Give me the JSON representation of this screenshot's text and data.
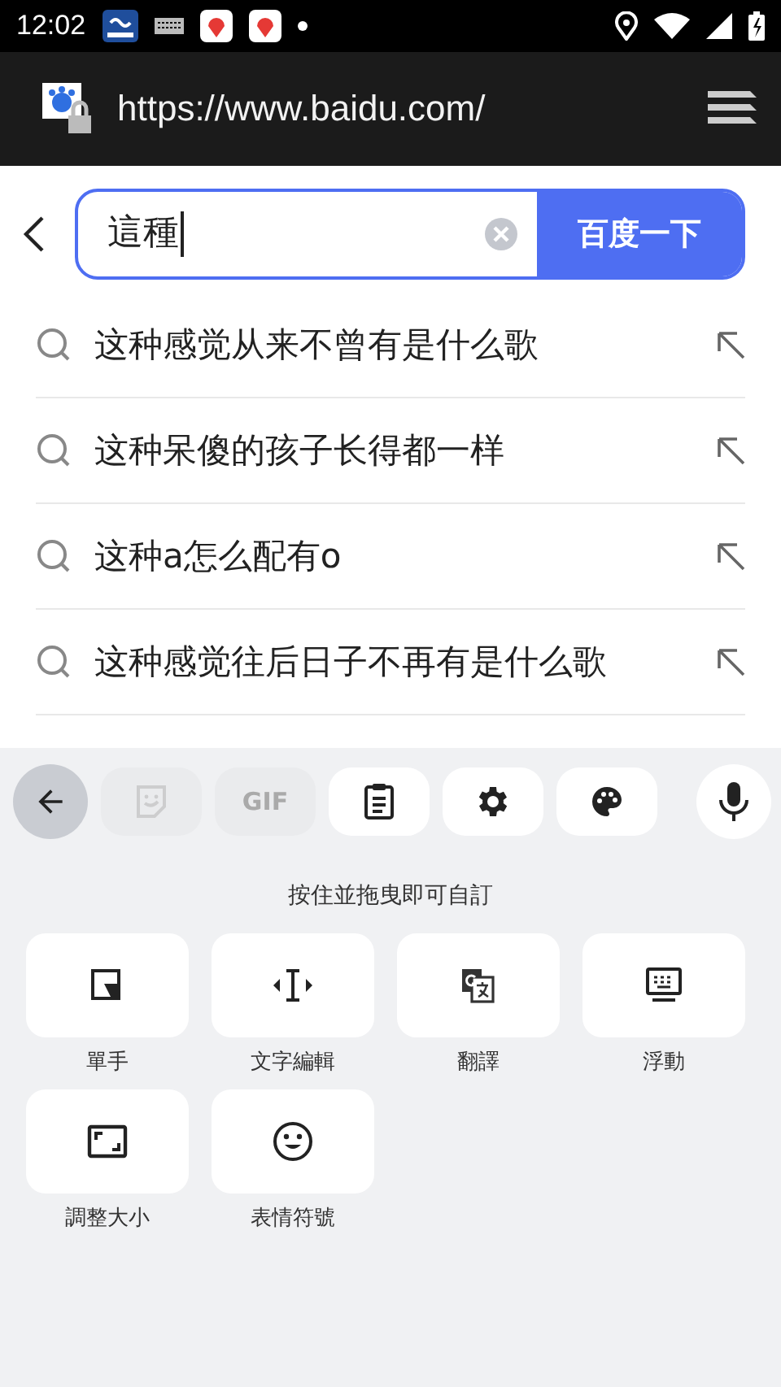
{
  "status_bar": {
    "time": "12:02"
  },
  "address_bar": {
    "url": "https://www.baidu.com/"
  },
  "search": {
    "value": "這種",
    "button": "百度一下"
  },
  "suggestions": [
    {
      "text": "这种感觉从来不曾有是什么歌"
    },
    {
      "text": "这种呆傻的孩子长得都一样"
    },
    {
      "text": "这种a怎么配有o"
    },
    {
      "text": "这种感觉往后日子不再有是什么歌"
    }
  ],
  "keyboard_toolbar": [
    {
      "kind": "back",
      "disabled": false
    },
    {
      "kind": "sticker",
      "disabled": true
    },
    {
      "kind": "gif",
      "label": "GIF",
      "disabled": true
    },
    {
      "kind": "clipboard",
      "disabled": false
    },
    {
      "kind": "settings",
      "disabled": false
    },
    {
      "kind": "palette",
      "disabled": false
    },
    {
      "kind": "mic",
      "disabled": false
    }
  ],
  "hint": "按住並拖曳即可自訂",
  "tiles": [
    {
      "kind": "one-hand",
      "label": "單手"
    },
    {
      "kind": "text-edit",
      "label": "文字編輯"
    },
    {
      "kind": "translate",
      "label": "翻譯"
    },
    {
      "kind": "floating",
      "label": "浮動"
    },
    {
      "kind": "resize",
      "label": "調整大小"
    },
    {
      "kind": "emoji",
      "label": "表情符號"
    }
  ]
}
